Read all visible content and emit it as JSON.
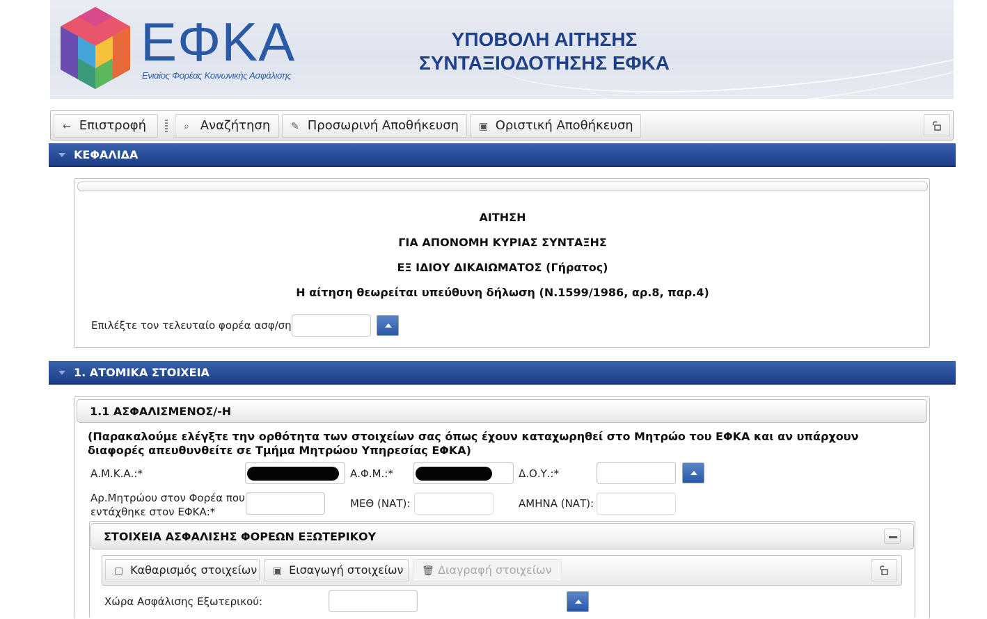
{
  "banner": {
    "logo_text": "ΕΦΚΑ",
    "logo_subtitle": "Ενιαίος Φορέας Κοινωνικής Ασφάλισης",
    "title_line1": "ΥΠΟΒΟΛΗ ΑΙΤΗΣΗΣ",
    "title_line2": "ΣΥΝΤΑΞΙΟΔΟΤΗΣΗΣ ΕΦΚΑ"
  },
  "toolbar": {
    "back_label": "Επιστροφή",
    "search_label": "Αναζήτηση",
    "temp_save_label": "Προσωρινή Αποθήκευση",
    "final_save_label": "Οριστική Αποθήκευση",
    "back_icon": "←",
    "search_icon": "⌕",
    "edit_icon": "✎",
    "save_icon": "▣",
    "lock_icon": "lock-icon"
  },
  "header_section": {
    "title": "ΚΕΦΑΛΙΔΑ",
    "line1": "ΑΙΤΗΣΗ",
    "line2": "ΓΙΑ ΑΠΟΝΟΜΗ ΚΥΡΙΑΣ ΣΥΝΤΑΞΗΣ",
    "line3": "ΕΞ ΙΔΙΟΥ ΔΙΚΑΙΩΜΑΤΟΣ (Γήρατος)",
    "line4": "Η αίτηση θεωρείται υπεύθυνη δήλωση (Ν.1599/1986, αρ.8, παρ.4)",
    "last_carrier_label": "Επιλέξτε τον τελευταίο φορέα ασφ/σης:",
    "last_carrier_value": ""
  },
  "personal_section": {
    "title": "1. ΑΤΟΜΙΚΑ ΣΤΟΙΧΕΙΑ",
    "insured_title": "1.1 ΑΣΦΑΛΙΣΜΕΝΟΣ/-Η",
    "note": "(Παρακαλούμε ελέγξτε την ορθότητα των στοιχείων σας όπως έχουν καταχωρηθεί στο Μητρώο του ΕΦΚΑ και αν υπάρχουν διαφορές απευθυνθείτε σε Τμήμα Μητρώου Υπηρεσίας ΕΦΚΑ)",
    "amka_label": "Α.Μ.Κ.Α.:*",
    "afm_label": "Α.Φ.Μ.:*",
    "doy_label": "Δ.Ο.Υ.:*",
    "doy_value": "",
    "registry_label_line1": "Αρ.Μητρώου στον Φορέα που",
    "registry_label_line2": "εντάχθηκε στον ΕΦΚΑ:*",
    "registry_value": "",
    "meth_label": "ΜΕΘ (ΝΑΤ):",
    "meth_value": "",
    "amhna_label": "ΑΜΗΝΑ (ΝΑΤ):",
    "amhna_value": ""
  },
  "foreign_section": {
    "title": "ΣΤΟΙΧΕΙΑ ΑΣΦΑΛΙΣΗΣ ΦΟΡΕΩΝ ΕΞΩΤΕΡΙΚΟΥ",
    "clear_label": "Καθαρισμός στοιχείων",
    "insert_label": "Εισαγωγή στοιχείων",
    "delete_label": "Διαγραφή στοιχείων",
    "clear_icon": "▢",
    "insert_icon": "▣",
    "delete_icon": "🗑",
    "country_label": "Χώρα Ασφάλισης Εξωτερικού:",
    "country_value": ""
  },
  "colors": {
    "section_blue": "#264c96",
    "brand_blue": "#2a5aa6"
  }
}
